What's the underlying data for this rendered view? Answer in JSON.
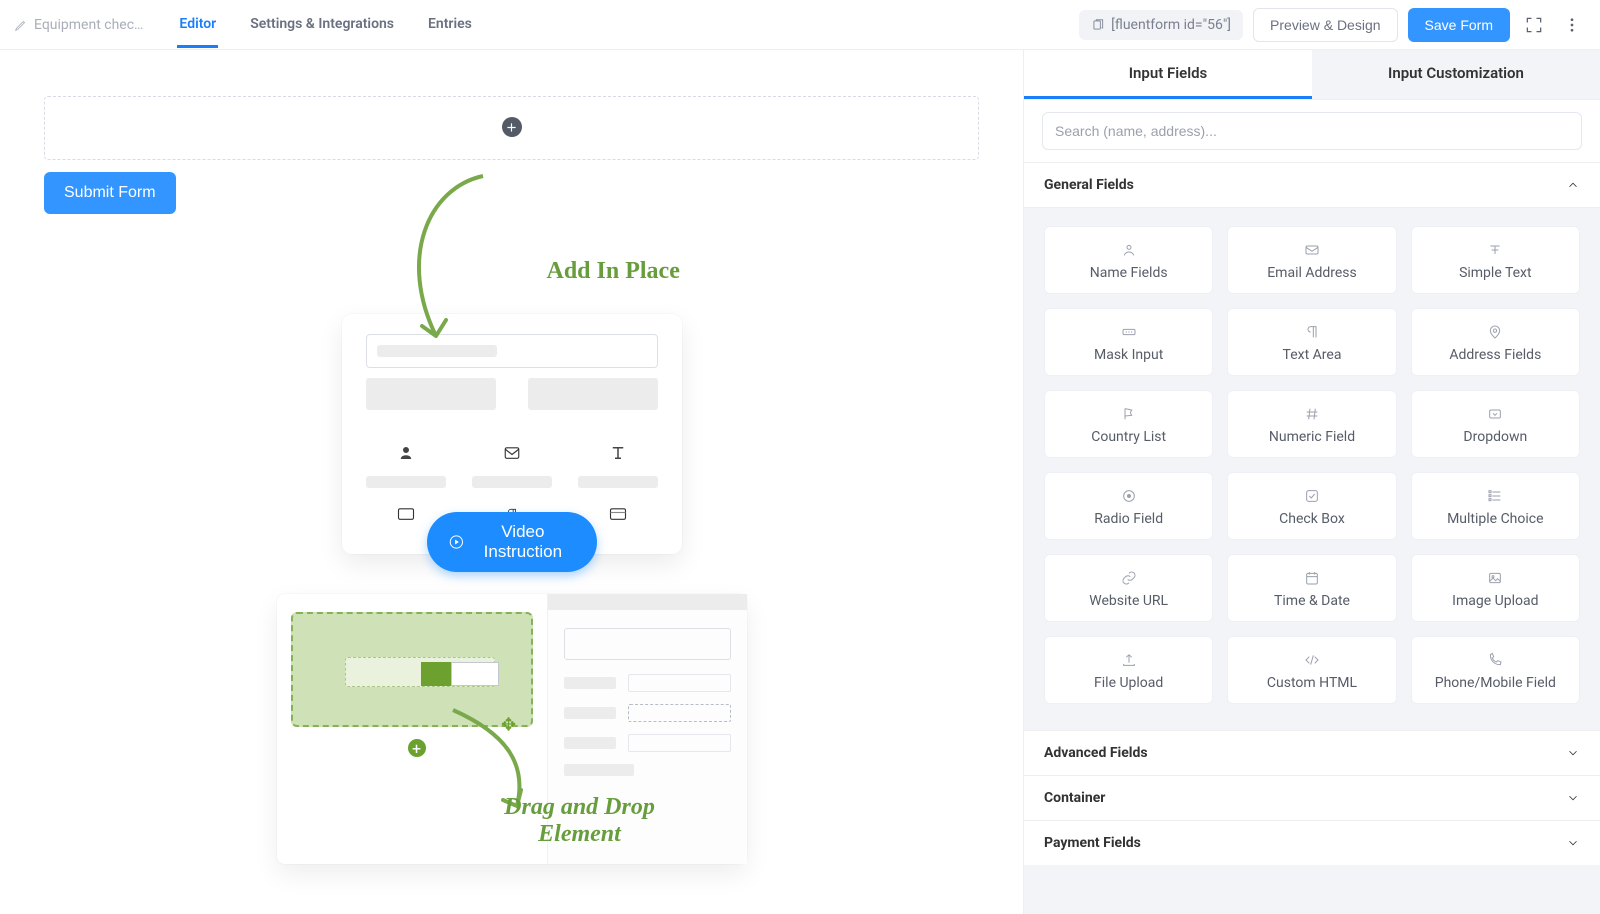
{
  "header": {
    "form_title": "Equipment chec…",
    "tabs": {
      "editor": "Editor",
      "settings": "Settings & Integrations",
      "entries": "Entries"
    },
    "shortcode": "[fluentform id=\"56\"]",
    "preview_label": "Preview & Design",
    "save_label": "Save Form"
  },
  "canvas": {
    "submit_label": "Submit Form",
    "add_in_place_label": "Add In Place",
    "drag_drop_label": "Drag and Drop Element",
    "video_label": "Video Instruction"
  },
  "search": {
    "placeholder": "Search (name, address)..."
  },
  "side_tabs": {
    "input_fields": "Input Fields",
    "customization": "Input Customization"
  },
  "sections": {
    "general_label": "General Fields",
    "advanced_label": "Advanced Fields",
    "container_label": "Container",
    "payment_label": "Payment Fields"
  },
  "general_fields": [
    {
      "id": "name",
      "label": "Name Fields"
    },
    {
      "id": "email",
      "label": "Email Address"
    },
    {
      "id": "text",
      "label": "Simple Text"
    },
    {
      "id": "mask",
      "label": "Mask Input"
    },
    {
      "id": "textarea",
      "label": "Text Area"
    },
    {
      "id": "address",
      "label": "Address Fields"
    },
    {
      "id": "country",
      "label": "Country List"
    },
    {
      "id": "numeric",
      "label": "Numeric Field"
    },
    {
      "id": "dropdown",
      "label": "Dropdown"
    },
    {
      "id": "radio",
      "label": "Radio Field"
    },
    {
      "id": "checkbox",
      "label": "Check Box"
    },
    {
      "id": "multichoice",
      "label": "Multiple Choice"
    },
    {
      "id": "url",
      "label": "Website URL"
    },
    {
      "id": "timedate",
      "label": "Time & Date"
    },
    {
      "id": "image",
      "label": "Image Upload"
    },
    {
      "id": "file",
      "label": "File Upload"
    },
    {
      "id": "html",
      "label": "Custom HTML"
    },
    {
      "id": "phone",
      "label": "Phone/Mobile Field"
    }
  ]
}
